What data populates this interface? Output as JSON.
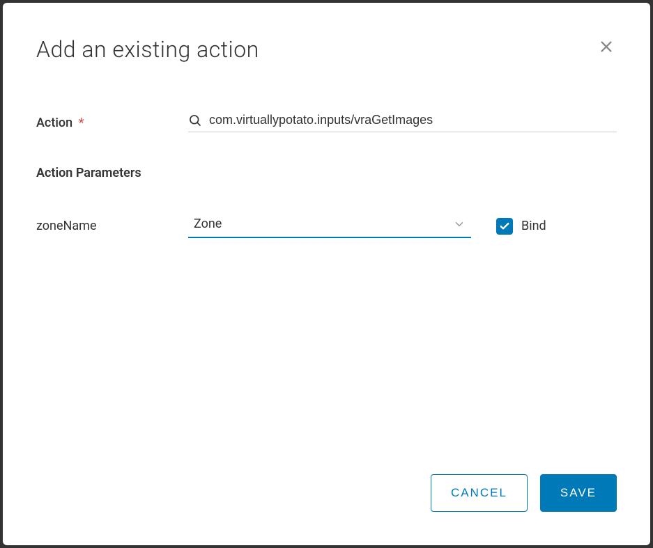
{
  "modal": {
    "title": "Add an existing action",
    "action": {
      "label": "Action",
      "required_marker": "*",
      "value": "com.virtuallypotato.inputs/vraGetImages"
    },
    "parameters": {
      "heading": "Action Parameters",
      "items": [
        {
          "name": "zoneName",
          "selected": "Zone",
          "bind_label": "Bind",
          "bind_checked": true
        }
      ]
    },
    "footer": {
      "cancel": "Cancel",
      "save": "Save"
    }
  }
}
